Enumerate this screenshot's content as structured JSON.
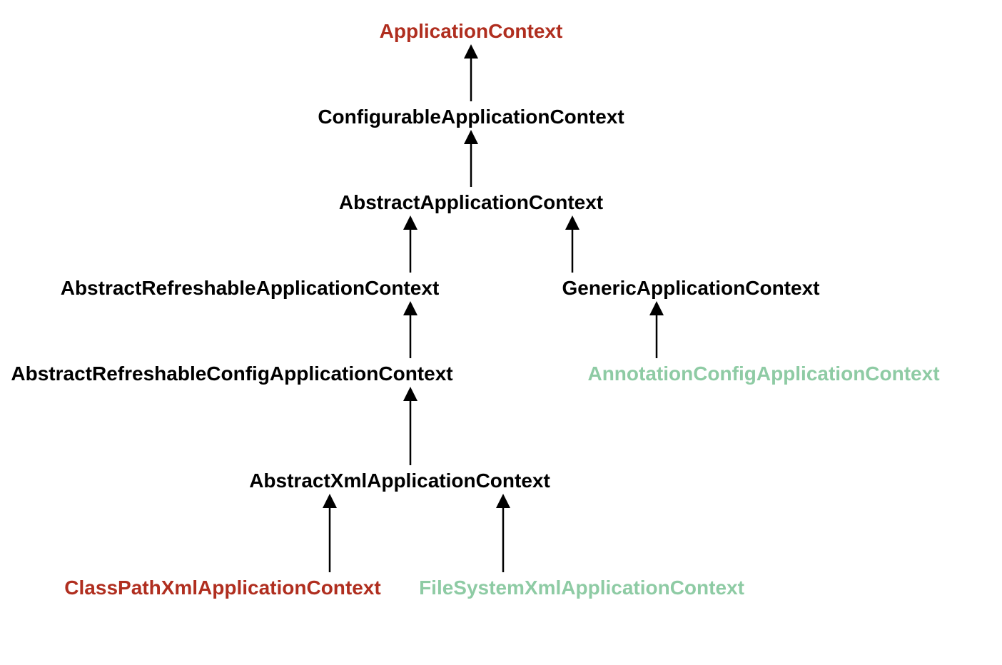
{
  "diagram": {
    "nodes": {
      "applicationContext": {
        "label": "ApplicationContext",
        "color": "red"
      },
      "configurableApplicationContext": {
        "label": "ConfigurableApplicationContext",
        "color": "black"
      },
      "abstractApplicationContext": {
        "label": "AbstractApplicationContext",
        "color": "black"
      },
      "abstractRefreshableApplicationContext": {
        "label": "AbstractRefreshableApplicationContext",
        "color": "black"
      },
      "genericApplicationContext": {
        "label": "GenericApplicationContext",
        "color": "black"
      },
      "abstractRefreshableConfigApplicationContext": {
        "label": "AbstractRefreshableConfigApplicationContext",
        "color": "black"
      },
      "annotationConfigApplicationContext": {
        "label": "AnnotationConfigApplicationContext",
        "color": "green"
      },
      "abstractXmlApplicationContext": {
        "label": "AbstractXmlApplicationContext",
        "color": "black"
      },
      "classPathXmlApplicationContext": {
        "label": "ClassPathXmlApplicationContext",
        "color": "red"
      },
      "fileSystemXmlApplicationContext": {
        "label": "FileSystemXmlApplicationContext",
        "color": "green"
      }
    },
    "edges": [
      {
        "from": "configurableApplicationContext",
        "to": "applicationContext"
      },
      {
        "from": "abstractApplicationContext",
        "to": "configurableApplicationContext"
      },
      {
        "from": "abstractRefreshableApplicationContext",
        "to": "abstractApplicationContext"
      },
      {
        "from": "genericApplicationContext",
        "to": "abstractApplicationContext"
      },
      {
        "from": "abstractRefreshableConfigApplicationContext",
        "to": "abstractRefreshableApplicationContext"
      },
      {
        "from": "annotationConfigApplicationContext",
        "to": "genericApplicationContext"
      },
      {
        "from": "abstractXmlApplicationContext",
        "to": "abstractRefreshableConfigApplicationContext"
      },
      {
        "from": "classPathXmlApplicationContext",
        "to": "abstractXmlApplicationContext"
      },
      {
        "from": "fileSystemXmlApplicationContext",
        "to": "abstractXmlApplicationContext"
      }
    ],
    "colors": {
      "red": "#B02E1F",
      "black": "#000000",
      "green": "#8ECBA4"
    }
  }
}
